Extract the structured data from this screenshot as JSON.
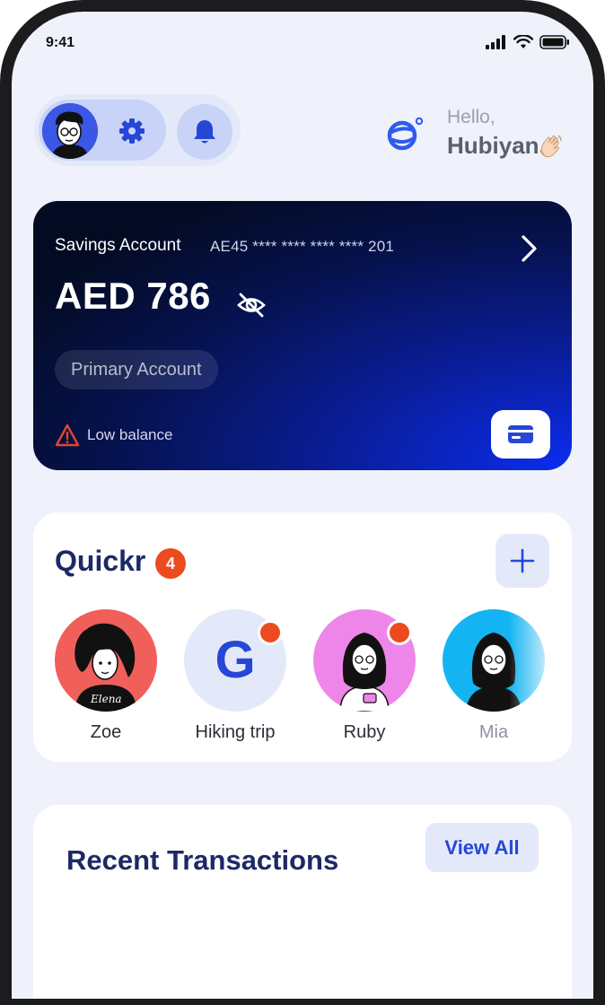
{
  "status_bar": {
    "time": "9:41"
  },
  "header": {
    "greeting_line1": "Hello,",
    "greeting_name": "Hubiyan",
    "wave_emoji": "👋🏻"
  },
  "account": {
    "type": "Savings Account",
    "number": "AE45 **** **** **** **** 201",
    "balance": "AED 786",
    "tag": "Primary Account",
    "warning": "Low balance"
  },
  "quickr": {
    "title": "Quickr",
    "badge_count": "4",
    "contacts": [
      {
        "name": "Zoe",
        "bg": "#f15f5a",
        "has_dot": false
      },
      {
        "name": "Hiking trip",
        "initial": "G",
        "bg": "#e4e9fa",
        "has_dot": true
      },
      {
        "name": "Ruby",
        "bg": "#ee86e9",
        "has_dot": true
      },
      {
        "name": "Mia",
        "bg": "#14b4f2",
        "has_dot": false
      }
    ]
  },
  "recent": {
    "title": "Recent Transactions",
    "view_all_label": "View All"
  },
  "colors": {
    "brand_blue": "#2647d6",
    "navy": "#1b2a66",
    "alert_orange": "#ec4b1f",
    "background": "#eff2fb"
  }
}
